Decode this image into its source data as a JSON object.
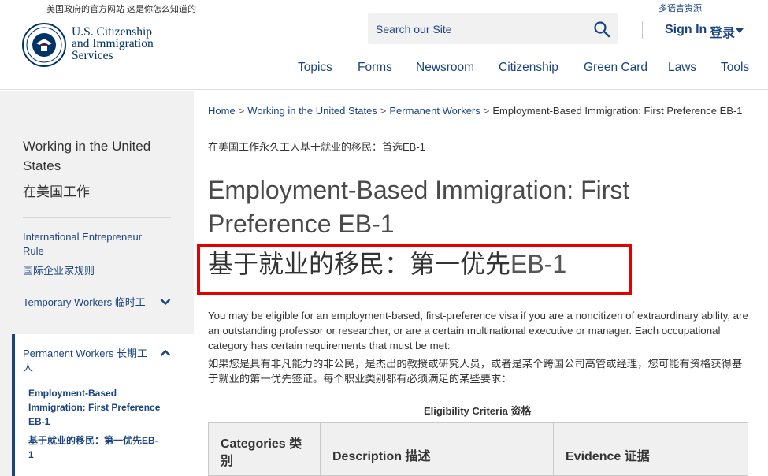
{
  "header": {
    "gov_note": "美国政府的官方网站 这是你怎么知道的",
    "lang_link": "多语言资源",
    "logo": {
      "line1": "U.S. Citizenship",
      "line2": "and Immigration",
      "line3": "Services"
    },
    "search": {
      "placeholder": "Search our Site"
    },
    "signin": "Sign In",
    "login_cn": "登录",
    "nav": [
      "Topics",
      "Forms",
      "Newsroom",
      "Citizenship",
      "Green Card",
      "Laws",
      "Tools"
    ]
  },
  "sidebar": {
    "title": "Working in the United States",
    "title_cn": "在美国工作",
    "items": [
      {
        "label": "International Entrepreneur Rule",
        "label_cn": "国际企业家规则"
      },
      {
        "label": "Temporary Workers 临时工"
      },
      {
        "label": "Permanent Workers 长期工人"
      }
    ],
    "sub_items": [
      {
        "label": "Employment-Based Immigration: First Preference EB-1"
      },
      {
        "label": "基于就业的移民：第一优先EB-1"
      }
    ]
  },
  "breadcrumb": {
    "home": "Home",
    "level1": "Working in the United States",
    "level2": "Permanent Workers",
    "current": "Employment-Based Immigration: First Preference EB-1",
    "current_cn": "在美国工作永久工人基于就业的移民：首选EB-1"
  },
  "main": {
    "title": "Employment-Based Immigration: First Preference EB-1",
    "title_cn_part1": "基于就业的移民：第一优先",
    "title_cn_part2": "EB-1",
    "intro": "You may be eligible for an employment-based, first-preference visa if you are a noncitizen of extraordinary ability, are an outstanding professor or researcher, or are a certain multinational executive or manager. Each occupational category has certain requirements that must be met:",
    "intro_cn": "如果您是具有非凡能力的非公民，是杰出的教授或研究人员，或者是某个跨国公司高管或经理，您可能有资格获得基于就业的第一优先签证。每个职业类别都有必须满足的某些要求：",
    "table_caption": "Eligibility Criteria 资格",
    "table_headers": [
      "Categories 类别",
      "Description 描述",
      "Evidence 证据"
    ]
  },
  "colors": {
    "primary": "#1a4480",
    "highlight": "#e30000",
    "sidebar_bg": "#f1f1f1"
  }
}
